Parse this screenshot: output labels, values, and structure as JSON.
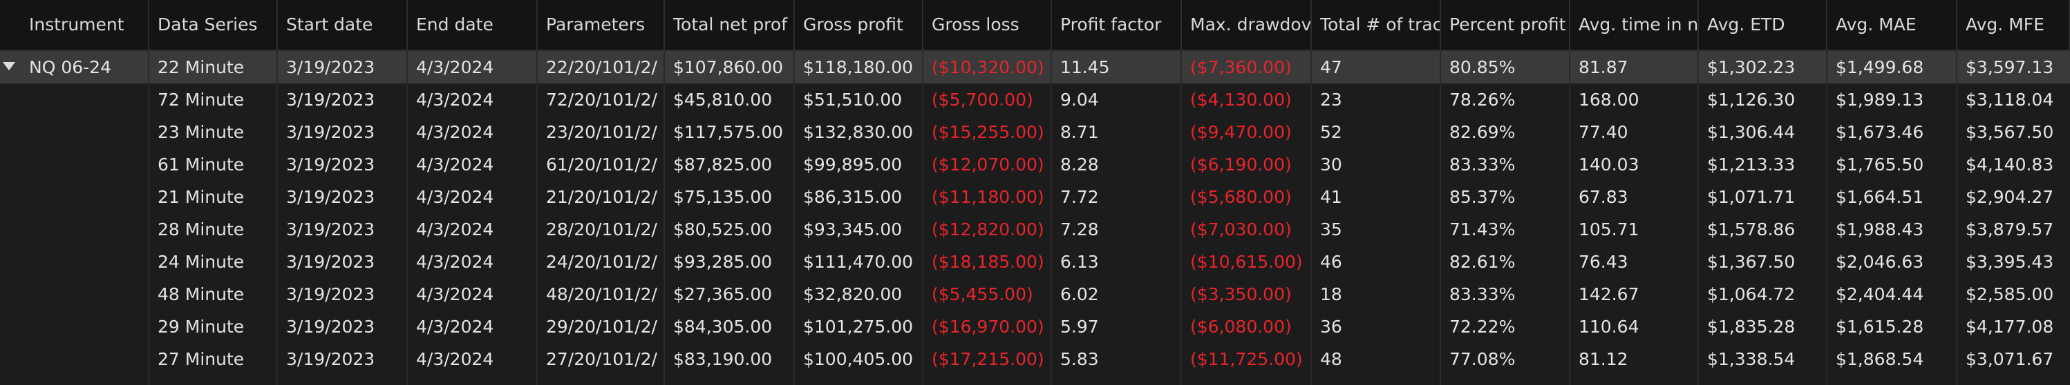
{
  "columns": [
    {
      "key": "instrument",
      "label": "Instrument"
    },
    {
      "key": "series",
      "label": "Data Series"
    },
    {
      "key": "start",
      "label": "Start date"
    },
    {
      "key": "end",
      "label": "End date"
    },
    {
      "key": "params",
      "label": "Parameters"
    },
    {
      "key": "net",
      "label": "Total net prof"
    },
    {
      "key": "gp",
      "label": "Gross profit"
    },
    {
      "key": "gl",
      "label": "Gross loss"
    },
    {
      "key": "pf",
      "label": "Profit factor"
    },
    {
      "key": "dd",
      "label": "Max. drawdov"
    },
    {
      "key": "trades",
      "label": "Total # of trac"
    },
    {
      "key": "pct",
      "label": "Percent profit"
    },
    {
      "key": "time",
      "label": "Avg. time in n"
    },
    {
      "key": "etd",
      "label": "Avg. ETD"
    },
    {
      "key": "mae",
      "label": "Avg. MAE"
    },
    {
      "key": "mfe",
      "label": "Avg. MFE"
    }
  ],
  "rows": [
    {
      "instrument": "NQ 06-24",
      "series": "22 Minute",
      "start": "3/19/2023",
      "end": "4/3/2024",
      "params": "22/20/101/2/",
      "net": "$107,860.00",
      "gp": "$118,180.00",
      "gl": "($10,320.00)",
      "pf": "11.45",
      "dd": "($7,360.00)",
      "trades": "47",
      "pct": "80.85%",
      "time": "81.87",
      "etd": "$1,302.23",
      "mae": "$1,499.68",
      "mfe": "$3,597.13"
    },
    {
      "instrument": "",
      "series": "72 Minute",
      "start": "3/19/2023",
      "end": "4/3/2024",
      "params": "72/20/101/2/",
      "net": "$45,810.00",
      "gp": "$51,510.00",
      "gl": "($5,700.00)",
      "pf": "9.04",
      "dd": "($4,130.00)",
      "trades": "23",
      "pct": "78.26%",
      "time": "168.00",
      "etd": "$1,126.30",
      "mae": "$1,989.13",
      "mfe": "$3,118.04"
    },
    {
      "instrument": "",
      "series": "23 Minute",
      "start": "3/19/2023",
      "end": "4/3/2024",
      "params": "23/20/101/2/",
      "net": "$117,575.00",
      "gp": "$132,830.00",
      "gl": "($15,255.00)",
      "pf": "8.71",
      "dd": "($9,470.00)",
      "trades": "52",
      "pct": "82.69%",
      "time": "77.40",
      "etd": "$1,306.44",
      "mae": "$1,673.46",
      "mfe": "$3,567.50"
    },
    {
      "instrument": "",
      "series": "61 Minute",
      "start": "3/19/2023",
      "end": "4/3/2024",
      "params": "61/20/101/2/",
      "net": "$87,825.00",
      "gp": "$99,895.00",
      "gl": "($12,070.00)",
      "pf": "8.28",
      "dd": "($6,190.00)",
      "trades": "30",
      "pct": "83.33%",
      "time": "140.03",
      "etd": "$1,213.33",
      "mae": "$1,765.50",
      "mfe": "$4,140.83"
    },
    {
      "instrument": "",
      "series": "21 Minute",
      "start": "3/19/2023",
      "end": "4/3/2024",
      "params": "21/20/101/2/",
      "net": "$75,135.00",
      "gp": "$86,315.00",
      "gl": "($11,180.00)",
      "pf": "7.72",
      "dd": "($5,680.00)",
      "trades": "41",
      "pct": "85.37%",
      "time": "67.83",
      "etd": "$1,071.71",
      "mae": "$1,664.51",
      "mfe": "$2,904.27"
    },
    {
      "instrument": "",
      "series": "28 Minute",
      "start": "3/19/2023",
      "end": "4/3/2024",
      "params": "28/20/101/2/",
      "net": "$80,525.00",
      "gp": "$93,345.00",
      "gl": "($12,820.00)",
      "pf": "7.28",
      "dd": "($7,030.00)",
      "trades": "35",
      "pct": "71.43%",
      "time": "105.71",
      "etd": "$1,578.86",
      "mae": "$1,988.43",
      "mfe": "$3,879.57"
    },
    {
      "instrument": "",
      "series": "24 Minute",
      "start": "3/19/2023",
      "end": "4/3/2024",
      "params": "24/20/101/2/",
      "net": "$93,285.00",
      "gp": "$111,470.00",
      "gl": "($18,185.00)",
      "pf": "6.13",
      "dd": "($10,615.00)",
      "trades": "46",
      "pct": "82.61%",
      "time": "76.43",
      "etd": "$1,367.50",
      "mae": "$2,046.63",
      "mfe": "$3,395.43"
    },
    {
      "instrument": "",
      "series": "48 Minute",
      "start": "3/19/2023",
      "end": "4/3/2024",
      "params": "48/20/101/2/",
      "net": "$27,365.00",
      "gp": "$32,820.00",
      "gl": "($5,455.00)",
      "pf": "6.02",
      "dd": "($3,350.00)",
      "trades": "18",
      "pct": "83.33%",
      "time": "142.67",
      "etd": "$1,064.72",
      "mae": "$2,404.44",
      "mfe": "$2,585.00"
    },
    {
      "instrument": "",
      "series": "29 Minute",
      "start": "3/19/2023",
      "end": "4/3/2024",
      "params": "29/20/101/2/",
      "net": "$84,305.00",
      "gp": "$101,275.00",
      "gl": "($16,970.00)",
      "pf": "5.97",
      "dd": "($6,080.00)",
      "trades": "36",
      "pct": "72.22%",
      "time": "110.64",
      "etd": "$1,835.28",
      "mae": "$1,615.28",
      "mfe": "$4,177.08"
    },
    {
      "instrument": "",
      "series": "27 Minute",
      "start": "3/19/2023",
      "end": "4/3/2024",
      "params": "27/20/101/2/",
      "net": "$83,190.00",
      "gp": "$100,405.00",
      "gl": "($17,215.00)",
      "pf": "5.83",
      "dd": "($11,725.00)",
      "trades": "48",
      "pct": "77.08%",
      "time": "81.12",
      "etd": "$1,338.54",
      "mae": "$1,868.54",
      "mfe": "$3,071.67"
    }
  ],
  "colors": {
    "negative": "#e8242c",
    "selected_row": "#3a3a3a",
    "header_bg": "#141414",
    "background": "#1c1c1c"
  },
  "icons": {
    "expander": "triangle-down-icon"
  }
}
